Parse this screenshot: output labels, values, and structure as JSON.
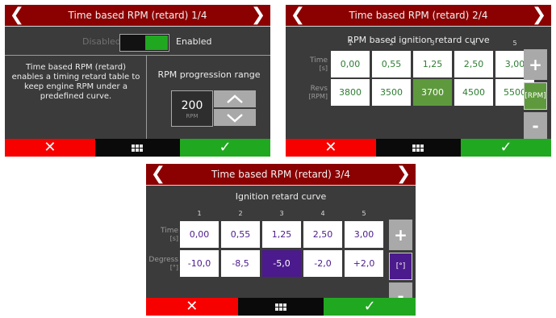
{
  "colors": {
    "header": "#8b0000",
    "screen_bg": "#3b3b3b",
    "cancel": "#f70000",
    "confirm": "#21a821",
    "rpm_accent": "#5e9a3d",
    "degree_accent": "#4b1a8c",
    "rpm_text": "#2e7d32",
    "degree_text": "#4b1a8c"
  },
  "icons": {
    "prev": "chevron-left-icon",
    "next": "chevron-right-icon",
    "cancel": "close-icon",
    "menu": "grid-icon",
    "confirm": "checkmark-icon",
    "increase": "chevron-up-icon",
    "decrease": "chevron-down-icon"
  },
  "screens": [
    {
      "title": "Time based RPM (retard) 1/4",
      "nav_prev": "❮",
      "nav_next": "❯",
      "toggle": {
        "off_label": "Disabled",
        "on_label": "Enabled",
        "enabled": true
      },
      "description": "Time based RPM (retard) enables a timing retard table to keep engine RPM under a predefined curve.",
      "range_label": "RPM progression range",
      "range_value": "200",
      "range_unit": "RPM",
      "footer": {
        "cancel": "✕",
        "confirm": "✓"
      }
    },
    {
      "title": "Time based RPM (retard) 2/4",
      "nav_prev": "❮",
      "nav_next": "❯",
      "table_title": "RPM based ignition retard curve",
      "columns": [
        "1",
        "2",
        "3",
        "4",
        "5"
      ],
      "row1_label": "Time",
      "row1_unit": "[s]",
      "row1": [
        "0,00",
        "0,55",
        "1,25",
        "2,50",
        "3,00"
      ],
      "row2_label": "Revs",
      "row2_unit": "[RPM]",
      "row2": [
        "3800",
        "3500",
        "3700",
        "4500",
        "5500"
      ],
      "selected_cell": 2,
      "side": {
        "plus": "+",
        "unit": "[RPM]",
        "minus": "-"
      },
      "footer": {
        "cancel": "✕",
        "confirm": "✓"
      }
    },
    {
      "title": "Time based RPM (retard) 3/4",
      "nav_prev": "❮",
      "nav_next": "❯",
      "table_title": "Ignition retard curve",
      "columns": [
        "1",
        "2",
        "3",
        "4",
        "5"
      ],
      "row1_label": "Time",
      "row1_unit": "[s]",
      "row1": [
        "0,00",
        "0,55",
        "1,25",
        "2,50",
        "3,00"
      ],
      "row2_label": "Degress",
      "row2_unit": "[°]",
      "row2": [
        "-10,0",
        "-8,5",
        "-5,0",
        "-2,0",
        "+2,0"
      ],
      "selected_cell": 2,
      "side": {
        "plus": "+",
        "unit": "[°]",
        "minus": "-"
      },
      "footer": {
        "cancel": "✕",
        "confirm": "✓"
      }
    }
  ]
}
